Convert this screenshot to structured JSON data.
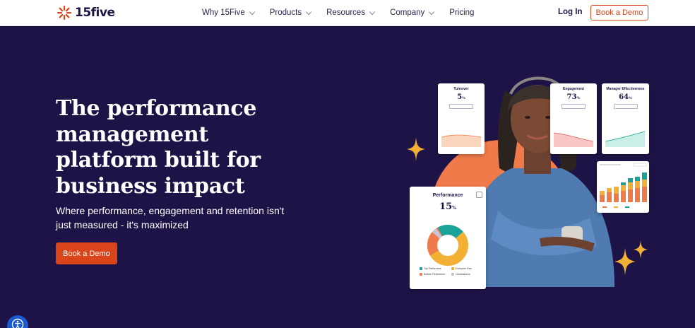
{
  "brand": {
    "name": "15five",
    "accent": "#d9441a",
    "background": "#1e1347"
  },
  "nav": {
    "items": [
      {
        "label": "Why 15Five",
        "has_dropdown": true
      },
      {
        "label": "Products",
        "has_dropdown": true
      },
      {
        "label": "Resources",
        "has_dropdown": true
      },
      {
        "label": "Company",
        "has_dropdown": true
      },
      {
        "label": "Pricing",
        "has_dropdown": false
      }
    ],
    "login": "Log In",
    "cta": "Book a Demo"
  },
  "hero": {
    "headline": "The performance management platform built for business impact",
    "subhead": "Where performance, engagement and retention isn't just measured - it's maximized",
    "cta": "Book a Demo"
  },
  "cards": {
    "turnover": {
      "title": "Turnover",
      "value": "5",
      "unit": "%"
    },
    "engagement": {
      "title": "Engagement",
      "value": "73",
      "unit": "%"
    },
    "manager": {
      "title": "Manager Effectiveness",
      "value": "64",
      "unit": "%"
    },
    "performance": {
      "title": "Performance",
      "value": "15",
      "unit": "%",
      "legend": [
        "Top Performers",
        "Everyone Else",
        "Bottom Performers",
        "Unmeasured"
      ],
      "legend_colors": [
        "#1aa39a",
        "#f2b134",
        "#f07a4a",
        "#c8c4d8"
      ]
    }
  },
  "icons": {
    "accessibility": "accessibility-icon",
    "logo": "starburst-logo-icon"
  }
}
